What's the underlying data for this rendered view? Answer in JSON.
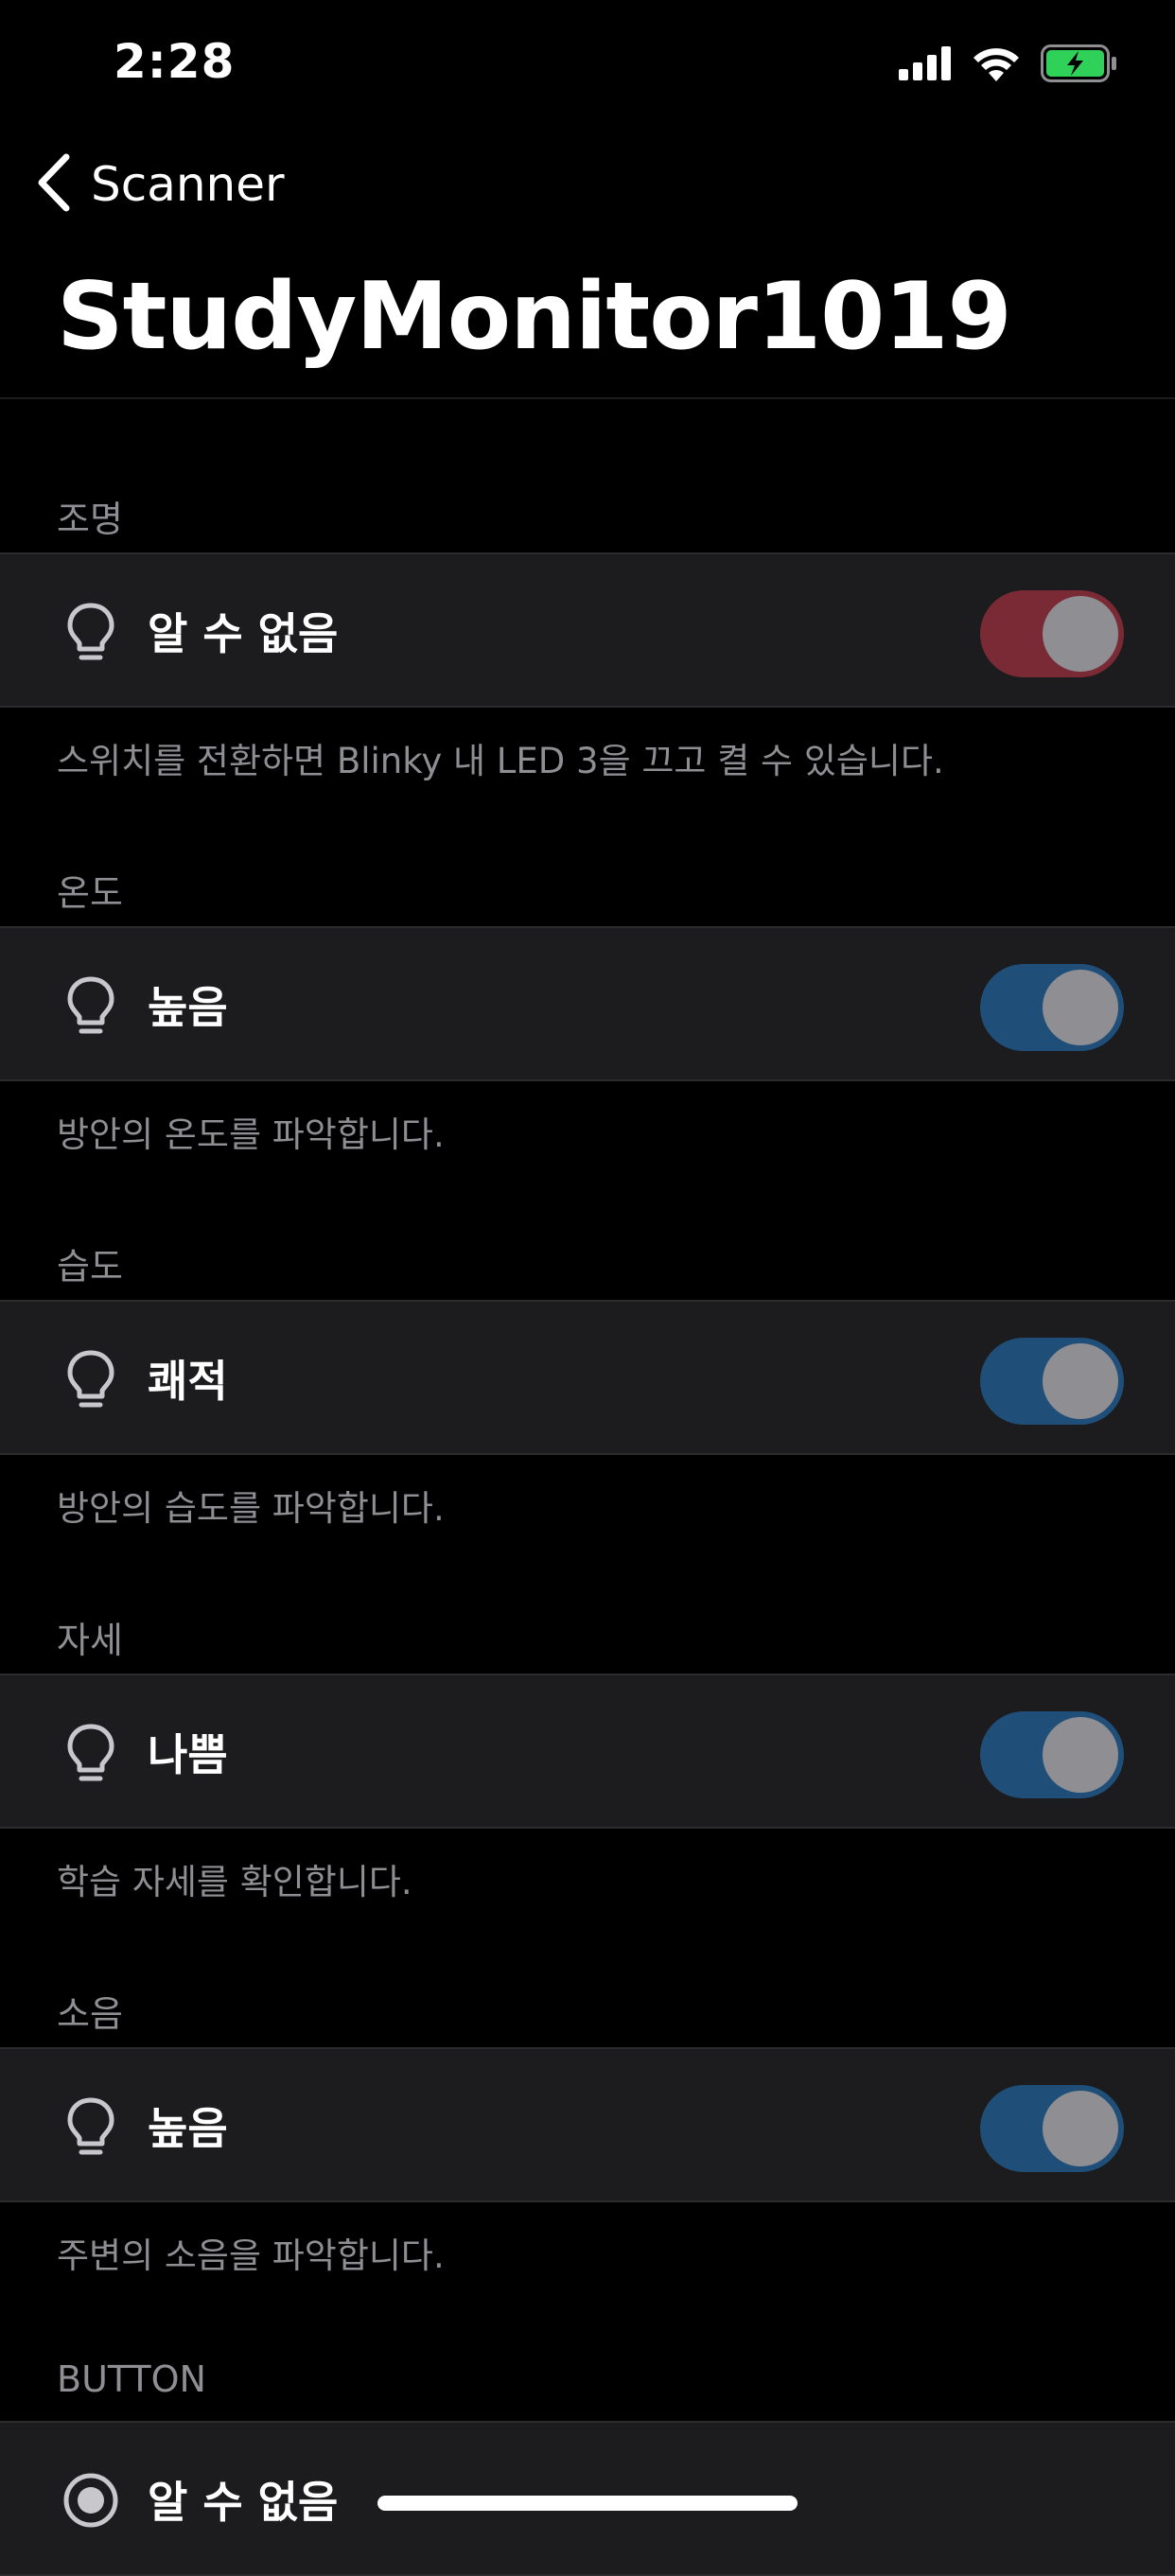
{
  "status_bar": {
    "time": "2:28",
    "icons": [
      "cellular-signal-icon",
      "wifi-icon",
      "battery-charging-icon"
    ],
    "battery_color": "#30d158"
  },
  "nav": {
    "back_label": "Scanner",
    "title": "StudyMonitor1019"
  },
  "colors": {
    "toggle_red": "#7a2a34",
    "toggle_blue": "#1f4f78",
    "toggle_knob": "#8e8e93",
    "row_bg": "#1c1c1e",
    "secondary_text": "#8e8e93"
  },
  "sections": [
    {
      "header": "조명",
      "label": "알 수 없음",
      "footer": "스위치를 전환하면 Blinky 내 LED 3을 끄고 켤 수 있습니다.",
      "icon": "lightbulb-icon",
      "toggle_color": "red"
    },
    {
      "header": "온도",
      "label": "높음",
      "footer": "방안의 온도를 파악합니다.",
      "icon": "lightbulb-icon",
      "toggle_color": "blue"
    },
    {
      "header": "습도",
      "label": "쾌적",
      "footer": "방안의 습도를 파악합니다.",
      "icon": "lightbulb-icon",
      "toggle_color": "blue"
    },
    {
      "header": "자세",
      "label": "나쁨",
      "footer": "학습 자세를 확인합니다.",
      "icon": "lightbulb-icon",
      "toggle_color": "blue"
    },
    {
      "header": "소음",
      "label": "높음",
      "footer": "주변의 소음을 파악합니다.",
      "icon": "lightbulb-icon",
      "toggle_color": "blue"
    },
    {
      "header": "BUTTON",
      "label": "알 수 없음",
      "icon": "radio-button-icon"
    }
  ]
}
